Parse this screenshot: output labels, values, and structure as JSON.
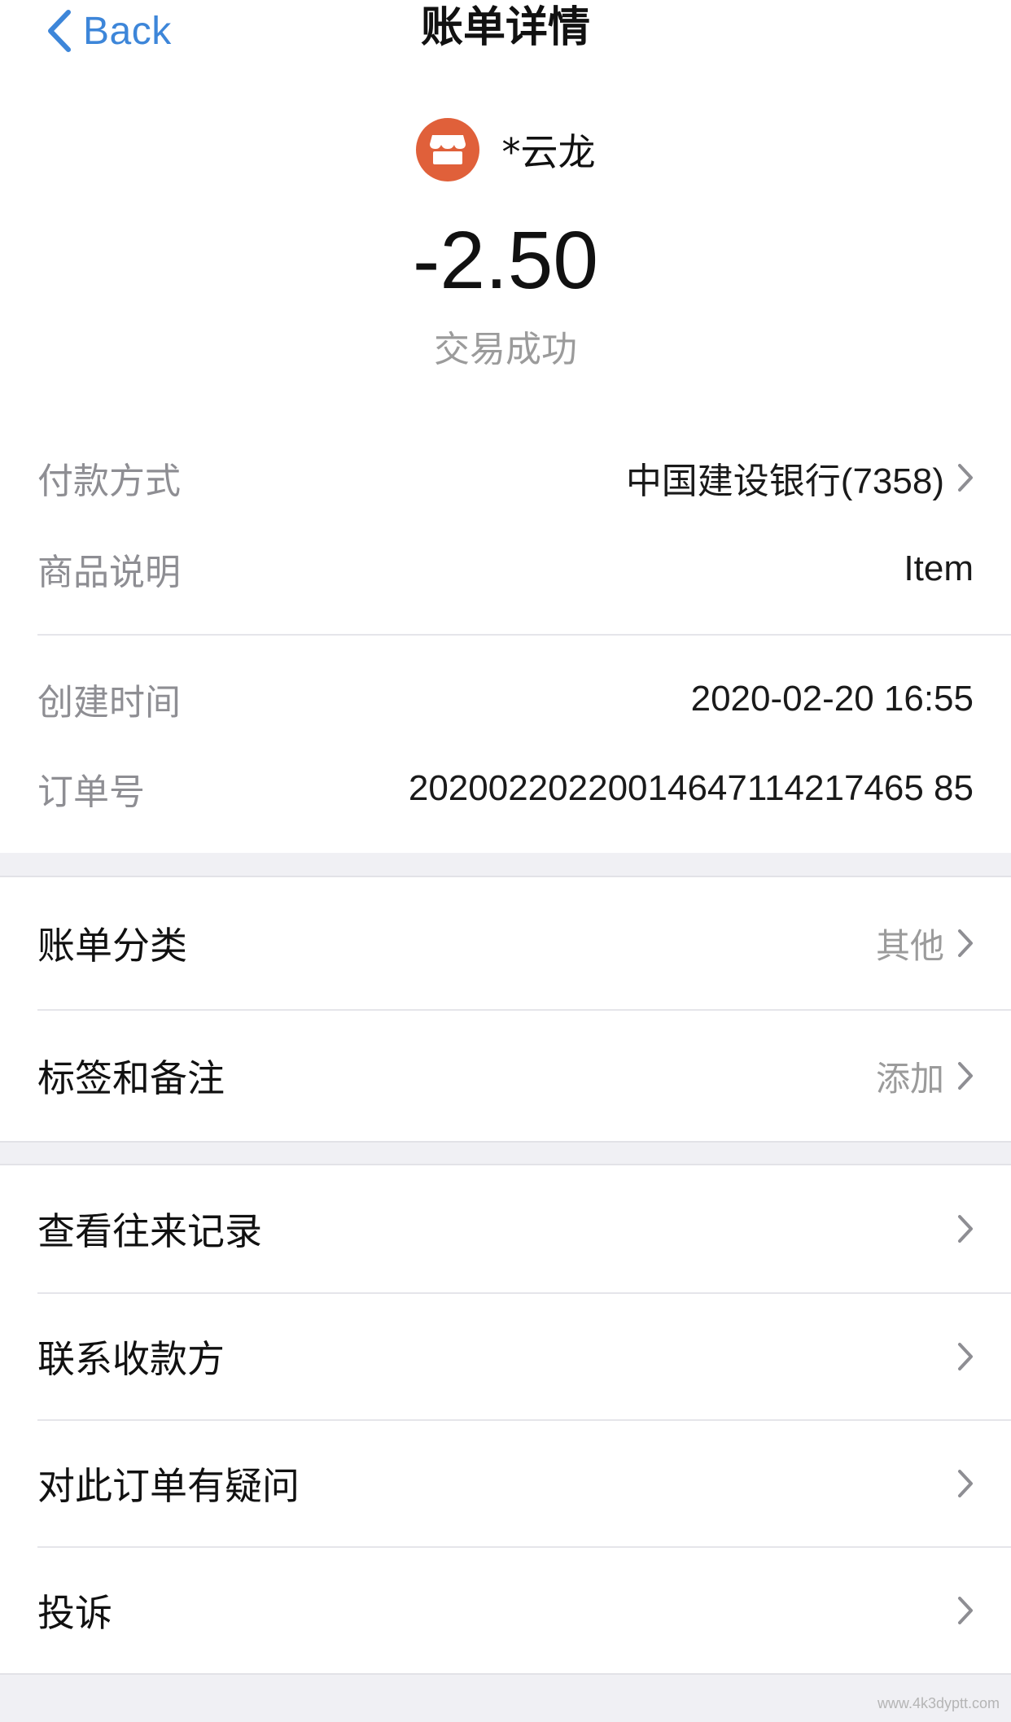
{
  "nav": {
    "back_label": "Back",
    "title": "账单详情"
  },
  "merchant": {
    "name": "*云龙",
    "icon": "store-icon",
    "color": "#e0603a"
  },
  "amount": "-2.50",
  "status": "交易成功",
  "details": [
    {
      "label": "付款方式",
      "value": "中国建设银行(7358)"
    },
    {
      "label": "商品说明",
      "value": "Item"
    },
    {
      "label": "创建时间",
      "value": "2020-02-20 16:55"
    },
    {
      "label": "订单号",
      "value": "20200220220014647114217465 85"
    }
  ],
  "section1": [
    {
      "title": "账单分类",
      "hint": "其他"
    },
    {
      "title": "标签和备注",
      "hint": "添加"
    }
  ],
  "section2": [
    {
      "title": "查看往来记录"
    },
    {
      "title": "联系收款方"
    },
    {
      "title": "对此订单有疑问"
    },
    {
      "title": "投诉"
    }
  ],
  "watermark": "www.4k3dyptt.com",
  "colors": {
    "accent": "#3d86d9",
    "background": "#f0f0f4"
  }
}
